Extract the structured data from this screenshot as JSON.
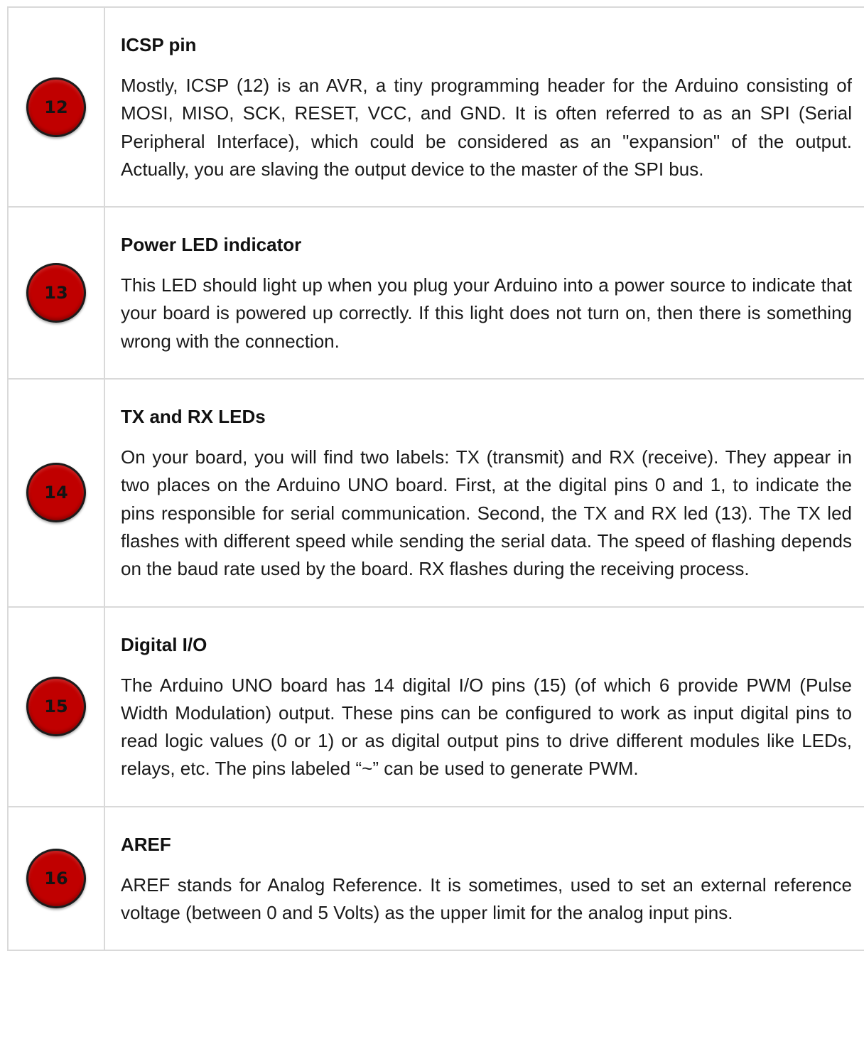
{
  "rows": [
    {
      "number": "12",
      "title": "ICSP pin",
      "text": "Mostly, ICSP (12) is an AVR, a tiny programming header for the Arduino consisting of MOSI, MISO, SCK, RESET, VCC, and GND. It is often referred to as an SPI (Serial Peripheral Interface), which could be considered as an \"expansion\" of the output. Actually, you are slaving the output device to the master of the SPI bus."
    },
    {
      "number": "13",
      "title": "Power LED indicator",
      "text": "This LED should light up when you plug your Arduino into a power source to indicate that your board is powered up correctly. If this light does not turn on, then there is something wrong with the connection."
    },
    {
      "number": "14",
      "title": "TX and RX LEDs",
      "text": "On your board, you will find two labels: TX (transmit) and RX (receive). They appear in two places on the Arduino UNO board. First, at the digital pins 0 and 1, to indicate the pins responsible for serial communication. Second, the TX and RX led (13). The TX  led flashes with different speed while sending the serial data. The speed of flashing depends on the baud rate used by the board. RX flashes during the receiving process."
    },
    {
      "number": "15",
      "title": "Digital I/O",
      "text": "The Arduino UNO board has 14 digital I/O pins (15) (of which 6 provide PWM (Pulse Width Modulation) output. These pins can be configured to work as input digital pins to read logic values (0 or 1) or as digital output pins to drive different modules like LEDs, relays, etc. The pins labeled “~” can be used to generate PWM."
    },
    {
      "number": "16",
      "title": "AREF",
      "text": "AREF stands for Analog Reference. It is sometimes, used to set an external reference voltage (between 0 and 5 Volts) as the upper limit for the analog input pins."
    }
  ],
  "colors": {
    "badge_fill": "#c00000",
    "badge_border": "#1c1c1c",
    "grid_line": "#d9d9d9"
  }
}
